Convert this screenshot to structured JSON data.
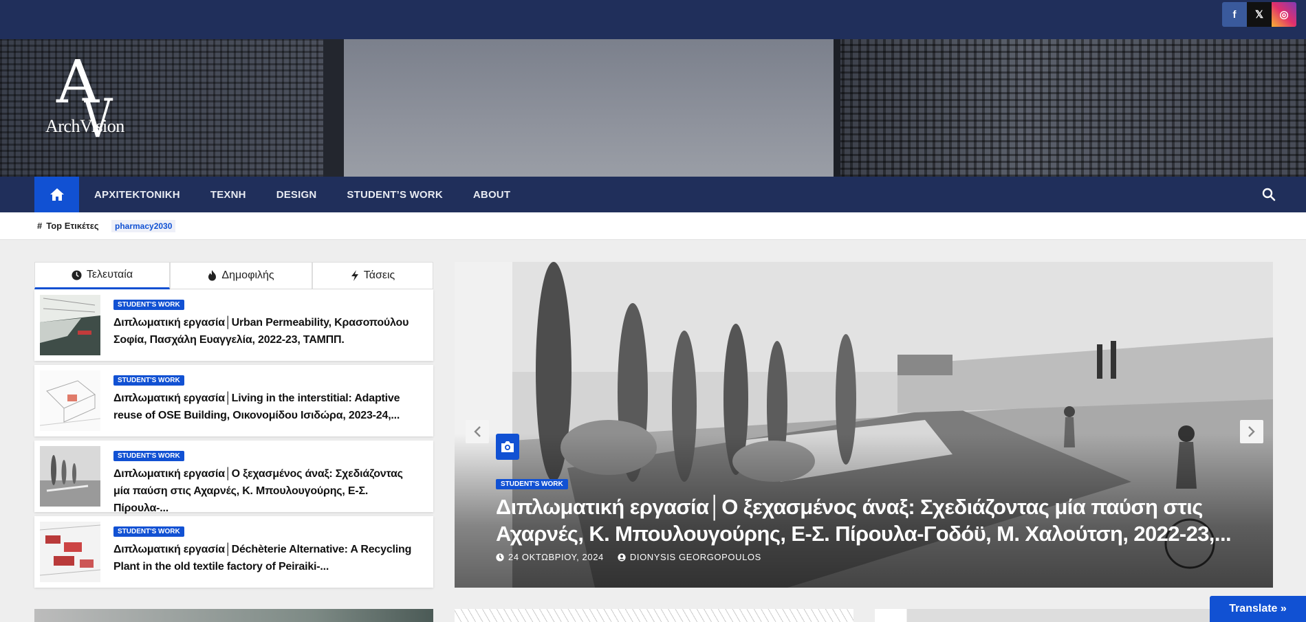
{
  "social": {
    "items": [
      {
        "name": "facebook",
        "glyph": "f"
      },
      {
        "name": "x",
        "glyph": "𝕏"
      },
      {
        "name": "instagram",
        "glyph": "◎"
      }
    ]
  },
  "logo": {
    "brand": "ArchVision",
    "mark_a": "A",
    "mark_v": "V"
  },
  "nav": {
    "items": [
      "ΑΡΧΙΤΕΚΤΟΝΙΚΗ",
      "ΤΕΧΝΗ",
      "DESIGN",
      "STUDENT’S WORK",
      "ABOUT"
    ]
  },
  "tags": {
    "heading": "Top Ετικέτες",
    "chip": "pharmacy2030"
  },
  "tabs": [
    "Τελευταία",
    "Δημοφιλής",
    "Τάσεις"
  ],
  "posts": [
    {
      "category": "STUDENT'S WORK",
      "title": "Διπλωματική εργασία│Urban Permeability, Κρασοπούλου Σοφία, Πασχάλη Ευαγγελία, 2022-23, ΤΑΜΠΠ."
    },
    {
      "category": "STUDENT'S WORK",
      "title": "Διπλωματική εργασία│Living in the interstitial: Adaptive reuse of OSE Building, Οικονομίδου Ισιδώρα, 2023-24,..."
    },
    {
      "category": "STUDENT'S WORK",
      "title": "Διπλωματική εργασία│Ο ξεχασμένος άναξ: Σχεδιάζοντας μία παύση στις Αχαρνές, Κ. Μπουλουγούρης, Ε-Σ. Πίρουλα-..."
    },
    {
      "category": "STUDENT'S WORK",
      "title": "Διπλωματική εργασία│Déchèterie Alternative: A Recycling Plant in the old textile factory of Peiraiki-..."
    }
  ],
  "hero": {
    "category": "STUDENT'S WORK",
    "title": "Διπλωματική εργασία│Ο ξεχασμένος άναξ: Σχεδιάζοντας μία παύση στις Αχαρνές, Κ. Μπουλουγούρης, Ε-Σ. Πίρουλα-Γοδόϋ, Μ. Χαλούτση, 2022-23,...",
    "date": "24 ΟΚΤΩΒΡΙΟΥ, 2024",
    "author": "DIONYSIS GEORGOPOULOS"
  },
  "translate": {
    "label": "Translate »"
  },
  "colors": {
    "navy": "#202f5b",
    "accent": "#1151d3"
  }
}
